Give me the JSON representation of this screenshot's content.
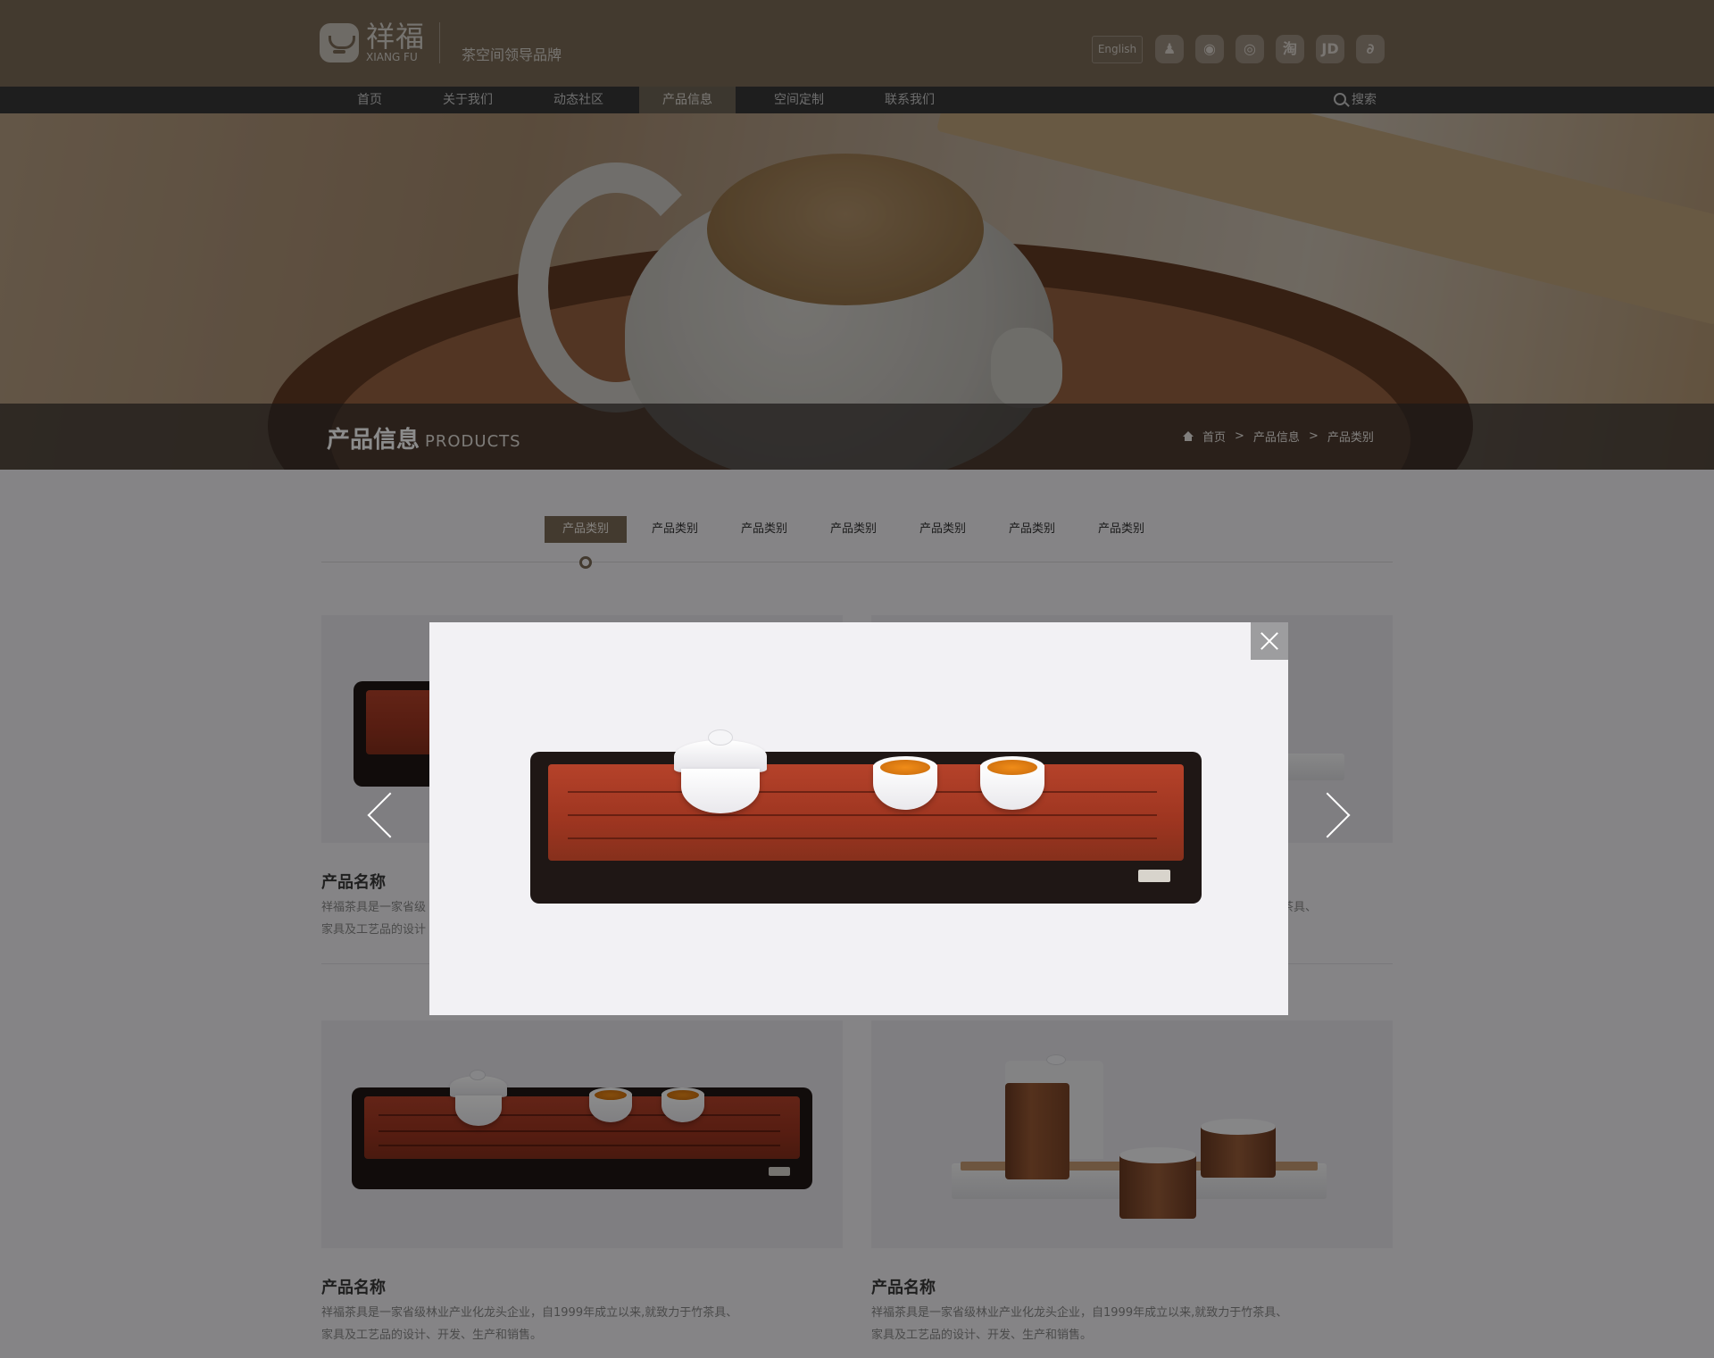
{
  "header": {
    "logo_cn": "祥福",
    "logo_en": "XIANG FU",
    "slogan": "茶空间领导品牌",
    "lang_button": "English",
    "social_icons": [
      {
        "name": "qq-icon",
        "glyph": "♟"
      },
      {
        "name": "wechat-icon",
        "glyph": "◉"
      },
      {
        "name": "weibo-icon",
        "glyph": "◎"
      },
      {
        "name": "taobao-icon",
        "glyph": "淘"
      },
      {
        "name": "jd-icon",
        "glyph": "JD"
      },
      {
        "name": "tmall-icon",
        "glyph": "∂"
      }
    ]
  },
  "nav": {
    "items": [
      "首页",
      "关于我们",
      "动态社区",
      "产品信息",
      "空间定制",
      "联系我们"
    ],
    "active_index": 3,
    "search_label": "搜索"
  },
  "banner": {
    "title": "产品信息",
    "title_en": "PRODUCTS",
    "breadcrumb": [
      "首页",
      ">",
      "产品信息",
      ">",
      "产品类别"
    ]
  },
  "categories": {
    "tabs": [
      "产品类别",
      "产品类别",
      "产品类别",
      "产品类别",
      "产品类别",
      "产品类别",
      "产品类别"
    ],
    "active_index": 0
  },
  "products": [
    {
      "name": "产品名称",
      "desc_line1": "祥福茶具是一家省级",
      "desc_line2": "家具及工艺品的设计"
    },
    {
      "name": "",
      "desc_line1": "茶具、",
      "desc_line2": ""
    },
    {
      "name": "产品名称",
      "desc_line1": "祥福茶具是一家省级林业产业化龙头企业，自1999年成立以来,就致力于竹茶具、",
      "desc_line2": "家具及工艺品的设计、开发、生产和销售。"
    },
    {
      "name": "产品名称",
      "desc_line1": "祥福茶具是一家省级林业产业化龙头企业，自1999年成立以来,就致力于竹茶具、",
      "desc_line2": "家具及工艺品的设计、开发、生产和销售。"
    }
  ],
  "colors": {
    "brand": "#7a6a57",
    "nav_bg": "#373737",
    "overlay": "rgba(0,0,0,0.45)"
  }
}
